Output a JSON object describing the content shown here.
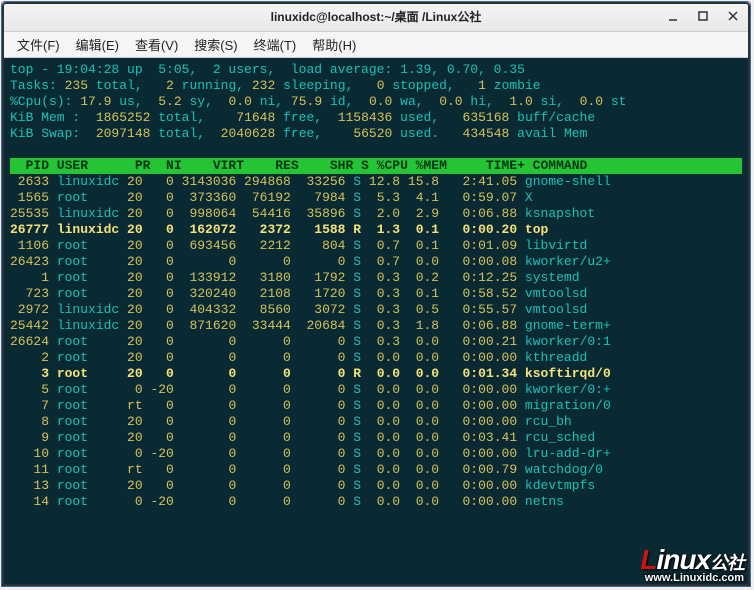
{
  "window": {
    "title": "linuxidc@localhost:~/桌面 /Linux公社"
  },
  "menu": {
    "items": [
      "文件(F)",
      "编辑(E)",
      "查看(V)",
      "搜索(S)",
      "终端(T)",
      "帮助(H)"
    ]
  },
  "top": {
    "line1": {
      "a": "top - 19:04:28 up  5:05,  2 users,  load average: 1.39, 0.70, 0.35"
    },
    "tasks": {
      "a": "Tasks: ",
      "total": "235 ",
      "b": "total,   ",
      "run": "2 ",
      "c": "running, ",
      "sleep": "232 ",
      "d": "sleeping,   ",
      "stop": "0 ",
      "e": "stopped,   ",
      "zomb": "1 ",
      "f": "zombie"
    },
    "cpu": {
      "a": "%Cpu(s): ",
      "us": "17.9 ",
      "b": "us,  ",
      "sy": "5.2 ",
      "c": "sy,  ",
      "ni": "0.0 ",
      "d": "ni, ",
      "id": "75.9 ",
      "e": "id,  ",
      "wa": "0.0 ",
      "f": "wa,  ",
      "hi": "0.0 ",
      "g": "hi,  ",
      "si": "1.0 ",
      "h": "si,  ",
      "st": "0.0 ",
      "i": "st"
    },
    "mem": {
      "a": "KiB Mem :  ",
      "total": "1865252 ",
      "b": "total,    ",
      "free": "71648 ",
      "c": "free,  ",
      "used": "1158436 ",
      "d": "used,   ",
      "cache": "635168 ",
      "e": "buff/cache"
    },
    "swap": {
      "a": "KiB Swap:  ",
      "total": "2097148 ",
      "b": "total,  ",
      "free": "2040628 ",
      "c": "free,    ",
      "used": "56520 ",
      "d": "used.   ",
      "avail": "434548 ",
      "e": "avail Mem"
    }
  },
  "header": "  PID USER      PR  NI    VIRT    RES    SHR S %CPU %MEM     TIME+ COMMAND    ",
  "rows": [
    {
      "pid": " 2633",
      "user": "linuxidc",
      "pr": "20",
      "ni": "0",
      "virt": "3143036",
      "res": "294868",
      "shr": "33256",
      "s": "S",
      "cpu": "12.8",
      "mem": "15.8",
      "time": "2:41.05",
      "cmd": "gnome-shell",
      "hl": false
    },
    {
      "pid": " 1565",
      "user": "root    ",
      "pr": "20",
      "ni": "0",
      "virt": "373360",
      "res": "76192",
      "shr": "7984",
      "s": "S",
      "cpu": "5.3",
      "mem": "4.1",
      "time": "0:59.07",
      "cmd": "X",
      "hl": false
    },
    {
      "pid": "25535",
      "user": "linuxidc",
      "pr": "20",
      "ni": "0",
      "virt": "998064",
      "res": "54416",
      "shr": "35896",
      "s": "S",
      "cpu": "2.0",
      "mem": "2.9",
      "time": "0:06.88",
      "cmd": "ksnapshot",
      "hl": false
    },
    {
      "pid": "26777",
      "user": "linuxidc",
      "pr": "20",
      "ni": "0",
      "virt": "162072",
      "res": "2372",
      "shr": "1588",
      "s": "R",
      "cpu": "1.3",
      "mem": "0.1",
      "time": "0:00.20",
      "cmd": "top",
      "hl": true
    },
    {
      "pid": " 1106",
      "user": "root    ",
      "pr": "20",
      "ni": "0",
      "virt": "693456",
      "res": "2212",
      "shr": "804",
      "s": "S",
      "cpu": "0.7",
      "mem": "0.1",
      "time": "0:01.09",
      "cmd": "libvirtd",
      "hl": false
    },
    {
      "pid": "26423",
      "user": "root    ",
      "pr": "20",
      "ni": "0",
      "virt": "0",
      "res": "0",
      "shr": "0",
      "s": "S",
      "cpu": "0.7",
      "mem": "0.0",
      "time": "0:00.08",
      "cmd": "kworker/u2+",
      "hl": false
    },
    {
      "pid": "    1",
      "user": "root    ",
      "pr": "20",
      "ni": "0",
      "virt": "133912",
      "res": "3180",
      "shr": "1792",
      "s": "S",
      "cpu": "0.3",
      "mem": "0.2",
      "time": "0:12.25",
      "cmd": "systemd",
      "hl": false
    },
    {
      "pid": "  723",
      "user": "root    ",
      "pr": "20",
      "ni": "0",
      "virt": "320240",
      "res": "2108",
      "shr": "1720",
      "s": "S",
      "cpu": "0.3",
      "mem": "0.1",
      "time": "0:58.52",
      "cmd": "vmtoolsd",
      "hl": false
    },
    {
      "pid": " 2972",
      "user": "linuxidc",
      "pr": "20",
      "ni": "0",
      "virt": "404332",
      "res": "8560",
      "shr": "3072",
      "s": "S",
      "cpu": "0.3",
      "mem": "0.5",
      "time": "0:55.57",
      "cmd": "vmtoolsd",
      "hl": false
    },
    {
      "pid": "25442",
      "user": "linuxidc",
      "pr": "20",
      "ni": "0",
      "virt": "871620",
      "res": "33444",
      "shr": "20684",
      "s": "S",
      "cpu": "0.3",
      "mem": "1.8",
      "time": "0:06.88",
      "cmd": "gnome-term+",
      "hl": false
    },
    {
      "pid": "26624",
      "user": "root    ",
      "pr": "20",
      "ni": "0",
      "virt": "0",
      "res": "0",
      "shr": "0",
      "s": "S",
      "cpu": "0.3",
      "mem": "0.0",
      "time": "0:00.21",
      "cmd": "kworker/0:1",
      "hl": false
    },
    {
      "pid": "    2",
      "user": "root    ",
      "pr": "20",
      "ni": "0",
      "virt": "0",
      "res": "0",
      "shr": "0",
      "s": "S",
      "cpu": "0.0",
      "mem": "0.0",
      "time": "0:00.00",
      "cmd": "kthreadd",
      "hl": false
    },
    {
      "pid": "    3",
      "user": "root    ",
      "pr": "20",
      "ni": "0",
      "virt": "0",
      "res": "0",
      "shr": "0",
      "s": "R",
      "cpu": "0.0",
      "mem": "0.0",
      "time": "0:01.34",
      "cmd": "ksoftirqd/0",
      "hl": true
    },
    {
      "pid": "    5",
      "user": "root    ",
      "pr": " 0",
      "ni": "-20",
      "virt": "0",
      "res": "0",
      "shr": "0",
      "s": "S",
      "cpu": "0.0",
      "mem": "0.0",
      "time": "0:00.00",
      "cmd": "kworker/0:+",
      "hl": false
    },
    {
      "pid": "    7",
      "user": "root    ",
      "pr": "rt",
      "ni": "0",
      "virt": "0",
      "res": "0",
      "shr": "0",
      "s": "S",
      "cpu": "0.0",
      "mem": "0.0",
      "time": "0:00.00",
      "cmd": "migration/0",
      "hl": false
    },
    {
      "pid": "    8",
      "user": "root    ",
      "pr": "20",
      "ni": "0",
      "virt": "0",
      "res": "0",
      "shr": "0",
      "s": "S",
      "cpu": "0.0",
      "mem": "0.0",
      "time": "0:00.00",
      "cmd": "rcu_bh",
      "hl": false
    },
    {
      "pid": "    9",
      "user": "root    ",
      "pr": "20",
      "ni": "0",
      "virt": "0",
      "res": "0",
      "shr": "0",
      "s": "S",
      "cpu": "0.0",
      "mem": "0.0",
      "time": "0:03.41",
      "cmd": "rcu_sched",
      "hl": false
    },
    {
      "pid": "   10",
      "user": "root    ",
      "pr": " 0",
      "ni": "-20",
      "virt": "0",
      "res": "0",
      "shr": "0",
      "s": "S",
      "cpu": "0.0",
      "mem": "0.0",
      "time": "0:00.00",
      "cmd": "lru-add-dr+",
      "hl": false
    },
    {
      "pid": "   11",
      "user": "root    ",
      "pr": "rt",
      "ni": "0",
      "virt": "0",
      "res": "0",
      "shr": "0",
      "s": "S",
      "cpu": "0.0",
      "mem": "0.0",
      "time": "0:00.79",
      "cmd": "watchdog/0",
      "hl": false
    },
    {
      "pid": "   13",
      "user": "root    ",
      "pr": "20",
      "ni": "0",
      "virt": "0",
      "res": "0",
      "shr": "0",
      "s": "S",
      "cpu": "0.0",
      "mem": "0.0",
      "time": "0:00.00",
      "cmd": "kdevtmpfs",
      "hl": false
    },
    {
      "pid": "   14",
      "user": "root    ",
      "pr": " 0",
      "ni": "-20",
      "virt": "0",
      "res": "0",
      "shr": "0",
      "s": "S",
      "cpu": "0.0",
      "mem": "0.0",
      "time": "0:00.00",
      "cmd": "netns",
      "hl": false
    }
  ],
  "watermark": {
    "main1": "L",
    "main2": "inux",
    "suffix": "公社",
    "sub": "www.Linuxidc.com"
  }
}
